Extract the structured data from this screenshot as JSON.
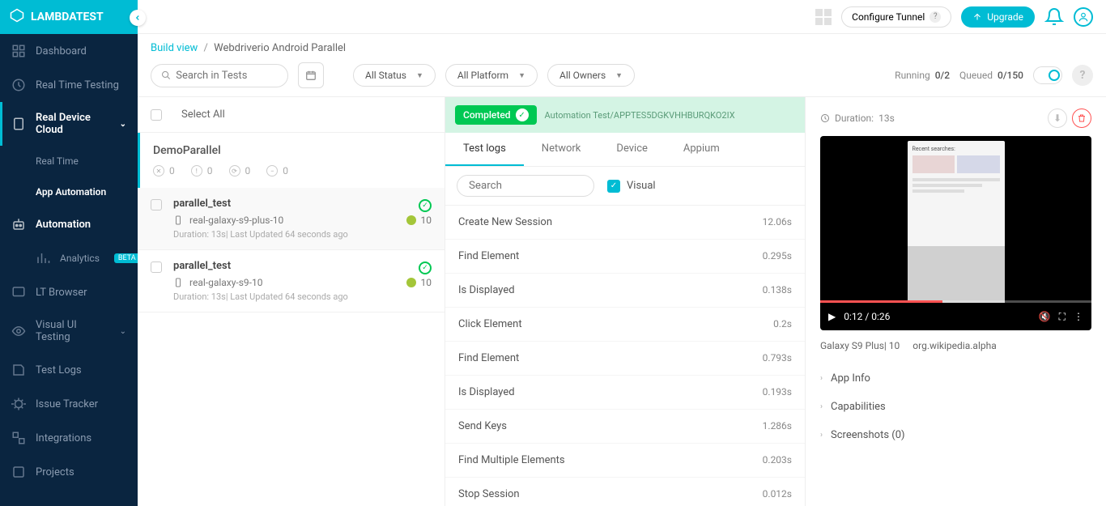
{
  "brand": "LAMBDATEST",
  "topbar": {
    "tunnel": "Configure Tunnel",
    "upgrade": "Upgrade"
  },
  "breadcrumb": {
    "root": "Build view",
    "current": "Webdriverio Android Parallel"
  },
  "filters": {
    "search_placeholder": "Search in Tests",
    "status": "All Status",
    "platform": "All Platform",
    "owners": "All Owners",
    "running_label": "Running",
    "running_val": "0/2",
    "queued_label": "Queued",
    "queued_val": "0/150"
  },
  "sidebar": {
    "dashboard": "Dashboard",
    "realtime_testing": "Real Time Testing",
    "real_device_cloud": "Real Device Cloud",
    "real_time": "Real Time",
    "app_automation": "App Automation",
    "automation": "Automation",
    "analytics": "Analytics",
    "analytics_badge": "BETA",
    "lt_browser": "LT Browser",
    "visual_ui": "Visual UI Testing",
    "test_logs": "Test Logs",
    "issue_tracker": "Issue Tracker",
    "integrations": "Integrations",
    "projects": "Projects"
  },
  "tests": {
    "select_all": "Select All",
    "group_name": "DemoParallel",
    "stats": [
      "0",
      "0",
      "0",
      "0"
    ],
    "items": [
      {
        "name": "parallel_test",
        "device": "real-galaxy-s9-plus-10",
        "os_ver": "10",
        "meta": "Duration: 13s| Last Updated 64 seconds ago"
      },
      {
        "name": "parallel_test",
        "device": "real-galaxy-s9-10",
        "os_ver": "10",
        "meta": "Duration: 13s| Last Updated 64 seconds ago"
      }
    ]
  },
  "logs": {
    "status": "Completed",
    "path": "Automation Test/APPTES5DGKVHHBURQKO2IX",
    "tabs": {
      "test_logs": "Test logs",
      "network": "Network",
      "device": "Device",
      "appium": "Appium"
    },
    "search_placeholder": "Search",
    "visual": "Visual",
    "rows": [
      {
        "name": "Create New Session",
        "time": "12.06s"
      },
      {
        "name": "Find Element",
        "time": "0.295s"
      },
      {
        "name": "Is Displayed",
        "time": "0.138s"
      },
      {
        "name": "Click Element",
        "time": "0.2s"
      },
      {
        "name": "Find Element",
        "time": "0.793s"
      },
      {
        "name": "Is Displayed",
        "time": "0.193s"
      },
      {
        "name": "Send Keys",
        "time": "1.286s"
      },
      {
        "name": "Find Multiple Elements",
        "time": "0.203s"
      },
      {
        "name": "Stop Session",
        "time": "0.012s"
      }
    ]
  },
  "details": {
    "duration_label": "Duration:",
    "duration_val": "13s",
    "video_time": "0:12 / 0:26",
    "recent_searches": "Recent searches:",
    "device": "Galaxy S9 Plus| 10",
    "app": "org.wikipedia.alpha",
    "acc_app_info": "App Info",
    "acc_capabilities": "Capabilities",
    "acc_screenshots": "Screenshots (0)"
  }
}
